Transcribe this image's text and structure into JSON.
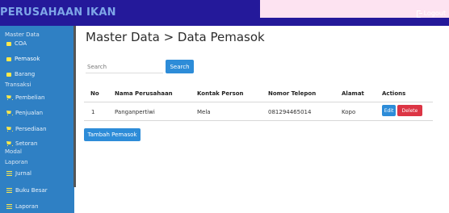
{
  "header": {
    "brand": "PERUSAHAAN IKAN",
    "logout_label": "Logout"
  },
  "sidebar": {
    "section_master": "Master Data",
    "items_master": [
      {
        "label": "COA"
      },
      {
        "label": "Pemasok"
      },
      {
        "label": "Barang"
      }
    ],
    "section_transaksi": "Transaksi",
    "items_transaksi": [
      {
        "label": "Pembelian"
      },
      {
        "label": "Penjualan"
      },
      {
        "label": "Persediaan"
      },
      {
        "label": "Setoran"
      }
    ],
    "modal_label": "Modal",
    "section_laporan": "Laporan",
    "items_laporan": [
      {
        "label": "Jurnal"
      },
      {
        "label": "Buku Besar"
      },
      {
        "label": "Laporan"
      }
    ]
  },
  "main": {
    "title": "Master Data > Data Pemasok",
    "search_placeholder": "Search",
    "search_button": "Search",
    "add_button": "Tambah Pemasok"
  },
  "table": {
    "headers": [
      "No",
      "Nama Perusahaan",
      "Kontak Person",
      "Nomor Telepon",
      "Alamat",
      "Actions"
    ],
    "rows": [
      {
        "no": "1",
        "nama": "Panganpertiwi",
        "kontak": "Mela",
        "telepon": "081294465014",
        "alamat": "Kopo"
      }
    ],
    "edit_label": "Edit",
    "delete_label": "Delete"
  }
}
